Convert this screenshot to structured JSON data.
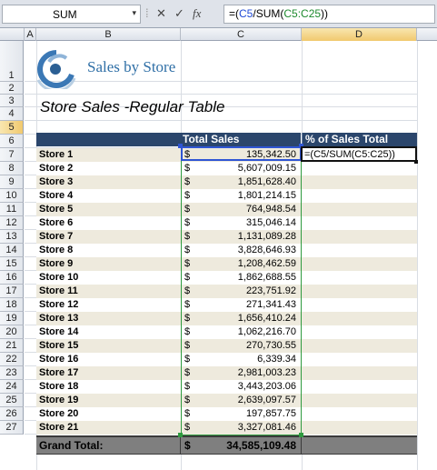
{
  "formula_bar": {
    "name_box": "SUM",
    "name_arrow": "▾",
    "cancel": "✕",
    "enter": "✓",
    "fx": "fx",
    "formula_prefix": "=(",
    "formula_ref1": "C5",
    "formula_mid": "/SUM(",
    "formula_ref2": "C5:C25",
    "formula_suffix": "))"
  },
  "columns": [
    "A",
    "B",
    "C",
    "D"
  ],
  "rows": [
    "1",
    "2",
    "3",
    "4",
    "5",
    "6",
    "7",
    "8",
    "9",
    "10",
    "11",
    "12",
    "13",
    "14",
    "15",
    "16",
    "17",
    "18",
    "19",
    "20",
    "21",
    "22",
    "23",
    "24",
    "25",
    "26",
    "27"
  ],
  "logo": {
    "text": "Sales by Store",
    "icon": "circular-c-logo"
  },
  "subtitle": "Store Sales -Regular Table",
  "table": {
    "header_sales": "Total Sales",
    "header_pct": "% of Sales Total",
    "currency": "$",
    "active_formula": "=(C5/SUM(C5:C25))",
    "stores": [
      {
        "name": "Store 1",
        "value": "135,342.50"
      },
      {
        "name": "Store 2",
        "value": "5,607,009.15"
      },
      {
        "name": "Store 3",
        "value": "1,851,628.40"
      },
      {
        "name": "Store 4",
        "value": "1,801,214.15"
      },
      {
        "name": "Store 5",
        "value": "764,948.54"
      },
      {
        "name": "Store 6",
        "value": "315,046.14"
      },
      {
        "name": "Store 7",
        "value": "1,131,089.28"
      },
      {
        "name": "Store 8",
        "value": "3,828,646.93"
      },
      {
        "name": "Store 9",
        "value": "1,208,462.59"
      },
      {
        "name": "Store 10",
        "value": "1,862,688.55"
      },
      {
        "name": "Store 11",
        "value": "223,751.92"
      },
      {
        "name": "Store 12",
        "value": "271,341.43"
      },
      {
        "name": "Store 13",
        "value": "1,656,410.24"
      },
      {
        "name": "Store 14",
        "value": "1,062,216.70"
      },
      {
        "name": "Store 15",
        "value": "270,730.55"
      },
      {
        "name": "Store 16",
        "value": "6,339.34"
      },
      {
        "name": "Store 17",
        "value": "2,981,003.23"
      },
      {
        "name": "Store 18",
        "value": "3,443,203.06"
      },
      {
        "name": "Store 19",
        "value": "2,639,097.57"
      },
      {
        "name": "Store 20",
        "value": "197,857.75"
      },
      {
        "name": "Store 21",
        "value": "3,327,081.46"
      }
    ],
    "grand_label": "Grand Total:",
    "grand_value": "34,585,109.48"
  },
  "colors": {
    "header_bg": "#2b466c",
    "band": "#eeeadd",
    "grand_bg": "#7f7f7f",
    "ref_blue": "#1f49d6",
    "ref_green": "#1e8a2e"
  }
}
